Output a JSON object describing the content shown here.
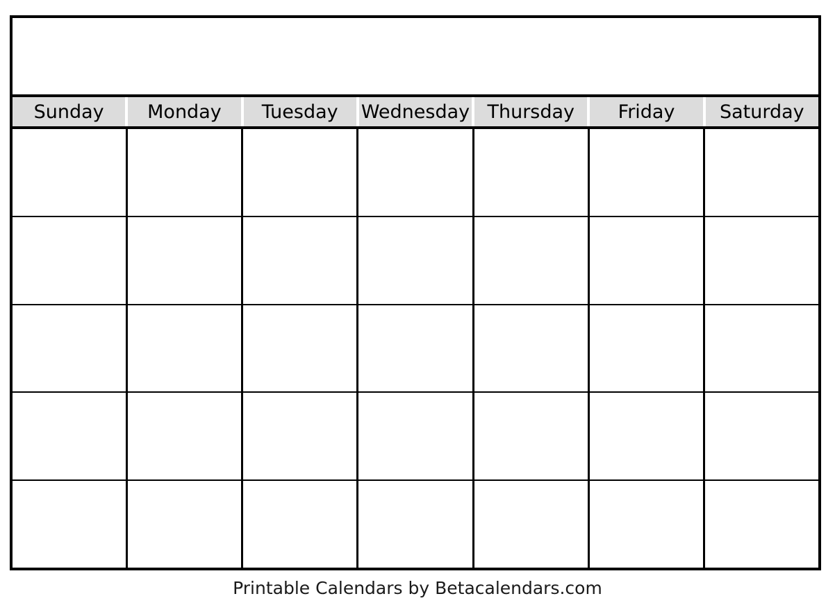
{
  "calendar": {
    "title": "",
    "weekday_headers": [
      "Sunday",
      "Monday",
      "Tuesday",
      "Wednesday",
      "Thursday",
      "Friday",
      "Saturday"
    ],
    "weeks": [
      {
        "days": [
          "",
          "",
          "",
          "",
          "",
          "",
          ""
        ]
      },
      {
        "days": [
          "",
          "",
          "",
          "",
          "",
          "",
          ""
        ]
      },
      {
        "days": [
          "",
          "",
          "",
          "",
          "",
          "",
          ""
        ]
      },
      {
        "days": [
          "",
          "",
          "",
          "",
          "",
          "",
          ""
        ]
      },
      {
        "days": [
          "",
          "",
          "",
          "",
          "",
          "",
          ""
        ]
      }
    ],
    "colors": {
      "border": "#000000",
      "weekday_header_background": "#dcdcdc",
      "cell_background": "#ffffff",
      "text": "#000000"
    }
  },
  "footer": {
    "credit": "Printable Calendars by Betacalendars.com"
  }
}
